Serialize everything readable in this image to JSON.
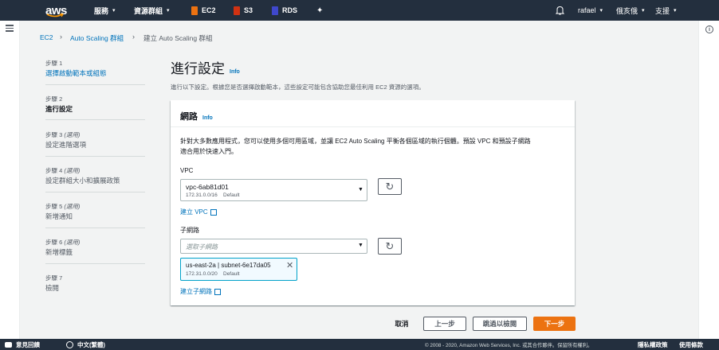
{
  "topnav": {
    "logo": "aws",
    "services": "服務",
    "resource_groups": "資源群組",
    "pinned": [
      {
        "label": "EC2",
        "color": "#ec7211"
      },
      {
        "label": "S3",
        "color": "#d13212"
      },
      {
        "label": "RDS",
        "color": "#3f48cc"
      }
    ],
    "user": "rafael",
    "region": "俄亥俄",
    "support": "支援"
  },
  "breadcrumb": {
    "items": [
      "EC2",
      "Auto Scaling 群組",
      "建立 Auto Scaling 群組"
    ]
  },
  "steps": [
    {
      "num": "步驟 1",
      "optional": "",
      "title": "選擇啟動範本或組態",
      "state": "link"
    },
    {
      "num": "步驟 2",
      "optional": "",
      "title": "進行設定",
      "state": "current"
    },
    {
      "num": "步驟 3",
      "optional": "(選用)",
      "title": "設定進階選項",
      "state": "pending"
    },
    {
      "num": "步驟 4",
      "optional": "(選用)",
      "title": "設定群組大小和擴展政策",
      "state": "pending"
    },
    {
      "num": "步驟 5",
      "optional": "(選用)",
      "title": "新增通知",
      "state": "pending"
    },
    {
      "num": "步驟 6",
      "optional": "(選用)",
      "title": "新增標籤",
      "state": "pending"
    },
    {
      "num": "步驟 7",
      "optional": "",
      "title": "檢閱",
      "state": "pending"
    }
  ],
  "page": {
    "title": "進行設定",
    "info": "Info",
    "description": "進行以下設定。根據您是否選擇啟動範本，這些設定可能包含協助您最佳利用 EC2 資源的選項。"
  },
  "network": {
    "title": "網路",
    "info": "Info",
    "description_line1": "針對大多數應用程式，您可以使用多個可用區域，並讓 EC2 Auto Scaling 平衡各個區域的執行個體。預設 VPC 和預設子網路",
    "description_line2": "適合用於快速入門。",
    "vpc_label": "VPC",
    "vpc_value": "vpc-6ab81d01",
    "vpc_cidr": "172.31.0.0/16",
    "vpc_default": "Default",
    "create_vpc": "建立 VPC",
    "subnet_label": "子網路",
    "subnet_placeholder": "選取子網路",
    "selected_subnet": {
      "name": "us-east-2a | subnet-6e17da05",
      "cidr": "172.31.0.0/20",
      "default": "Default"
    },
    "create_subnet": "建立子網路"
  },
  "actions": {
    "cancel": "取消",
    "previous": "上一步",
    "skip_to_review": "跳過以檢閱",
    "next": "下一步"
  },
  "footer": {
    "feedback": "意見回饋",
    "language": "中文(繁體)",
    "copyright": "© 2008 - 2020, Amazon Web Services, Inc. 或其合作夥伴。保留所有權利。",
    "privacy": "隱私權政策",
    "terms": "使用條款"
  },
  "colors": {
    "nav_bg": "#232f3e",
    "link": "#0073bb",
    "primary_button": "#ec7211",
    "page_bg": "#f2f3f3"
  }
}
